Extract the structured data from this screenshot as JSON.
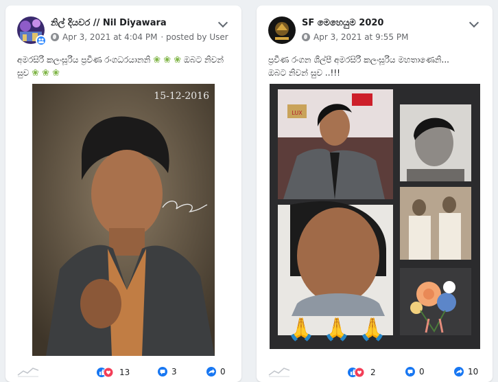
{
  "posts": [
    {
      "author": "නිල් දියවර // Nil Diyawara",
      "timestamp": "Apr 3, 2021 at 4:04 PM",
      "posted_by": "· posted by User",
      "caption_text": "අමරසිරි කලංසූරිය ප්‍රවීණ රංගධරයානනි",
      "caption_text2": "ඔබට නිවන් සුව",
      "photo_date": "15-12-2016",
      "reactions": "13",
      "comments": "3",
      "shares": "0"
    },
    {
      "author": "SF මෙහෙයුම 2020",
      "timestamp": "Apr 3, 2021 at 9:55 PM",
      "caption_line1": "ප්‍රවීණ රංගන ශිල්පී අමරසිරි කලංසූරිය මහතාණෙනි...",
      "caption_line2": "ඔබට නිවන් සුව ..!!!",
      "lux_label": "LUX",
      "reactions": "2",
      "comments": "0",
      "shares": "10"
    }
  ],
  "colors": {
    "background": "#edf0f3",
    "accent": "#1877f2",
    "muted": "#65676b"
  },
  "icons": [
    "globe-icon",
    "chevron-down-icon",
    "like-icon",
    "love-icon",
    "comment-icon",
    "share-icon",
    "trend-icon",
    "flower-icon",
    "praying-hands-icon"
  ]
}
